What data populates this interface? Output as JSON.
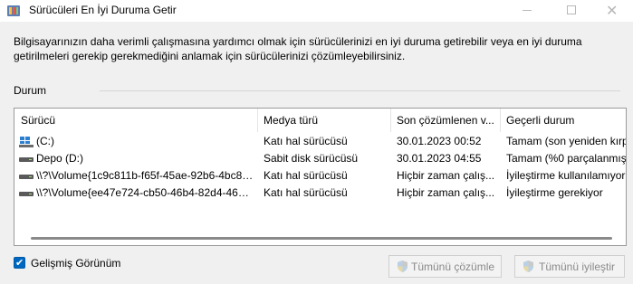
{
  "window": {
    "title": "Sürücüleri En İyi Duruma Getir",
    "minimize_glyph": "",
    "maximize_glyph": "",
    "close_glyph": "✕"
  },
  "description": "Bilgisayarınızın daha verimli çalışmasına yardımcı olmak için sürücülerinizi en iyi duruma getirebilir veya en iyi duruma getirilmeleri gerekip gerekmediğini anlamak için sürücülerinizi çözümleyebilirsiniz.",
  "status_group": {
    "label": "Durum",
    "columns": [
      "Sürücü",
      "Medya türü",
      "Son çözümlenen v...",
      "Geçerli durum"
    ],
    "rows": [
      {
        "icon": "windows-drive-icon",
        "drive": "(C:)",
        "media": "Katı hal sürücüsü",
        "last": "30.01.2023 00:52",
        "status": "Tamam (son yeniden kırp"
      },
      {
        "icon": "drive-icon",
        "drive": "Depo (D:)",
        "media": "Sabit disk sürücüsü",
        "last": "30.01.2023 04:55",
        "status": "Tamam (%0 parçalanmış)"
      },
      {
        "icon": "drive-icon",
        "drive": "\\\\?\\Volume{1c9c811b-f65f-45ae-92b6-4bc80...",
        "media": "Katı hal sürücüsü",
        "last": "Hiçbir zaman çalış...",
        "status": "İyileştirme kullanılamıyor"
      },
      {
        "icon": "drive-icon",
        "drive": "\\\\?\\Volume{ee47e724-cb50-46b4-82d4-461e...",
        "media": "Katı hal sürücüsü",
        "last": "Hiçbir zaman çalış...",
        "status": "İyileştirme gerekiyor"
      }
    ]
  },
  "advanced_view": {
    "label": "Gelişmiş Görünüm",
    "checked": true,
    "check_glyph": "✔"
  },
  "buttons": {
    "analyze_all": "Tümünü çözümle",
    "optimize_all": "Tümünü iyileştir"
  },
  "colors": {
    "accent": "#0067c0",
    "disabled_text": "#8a8a8a"
  }
}
